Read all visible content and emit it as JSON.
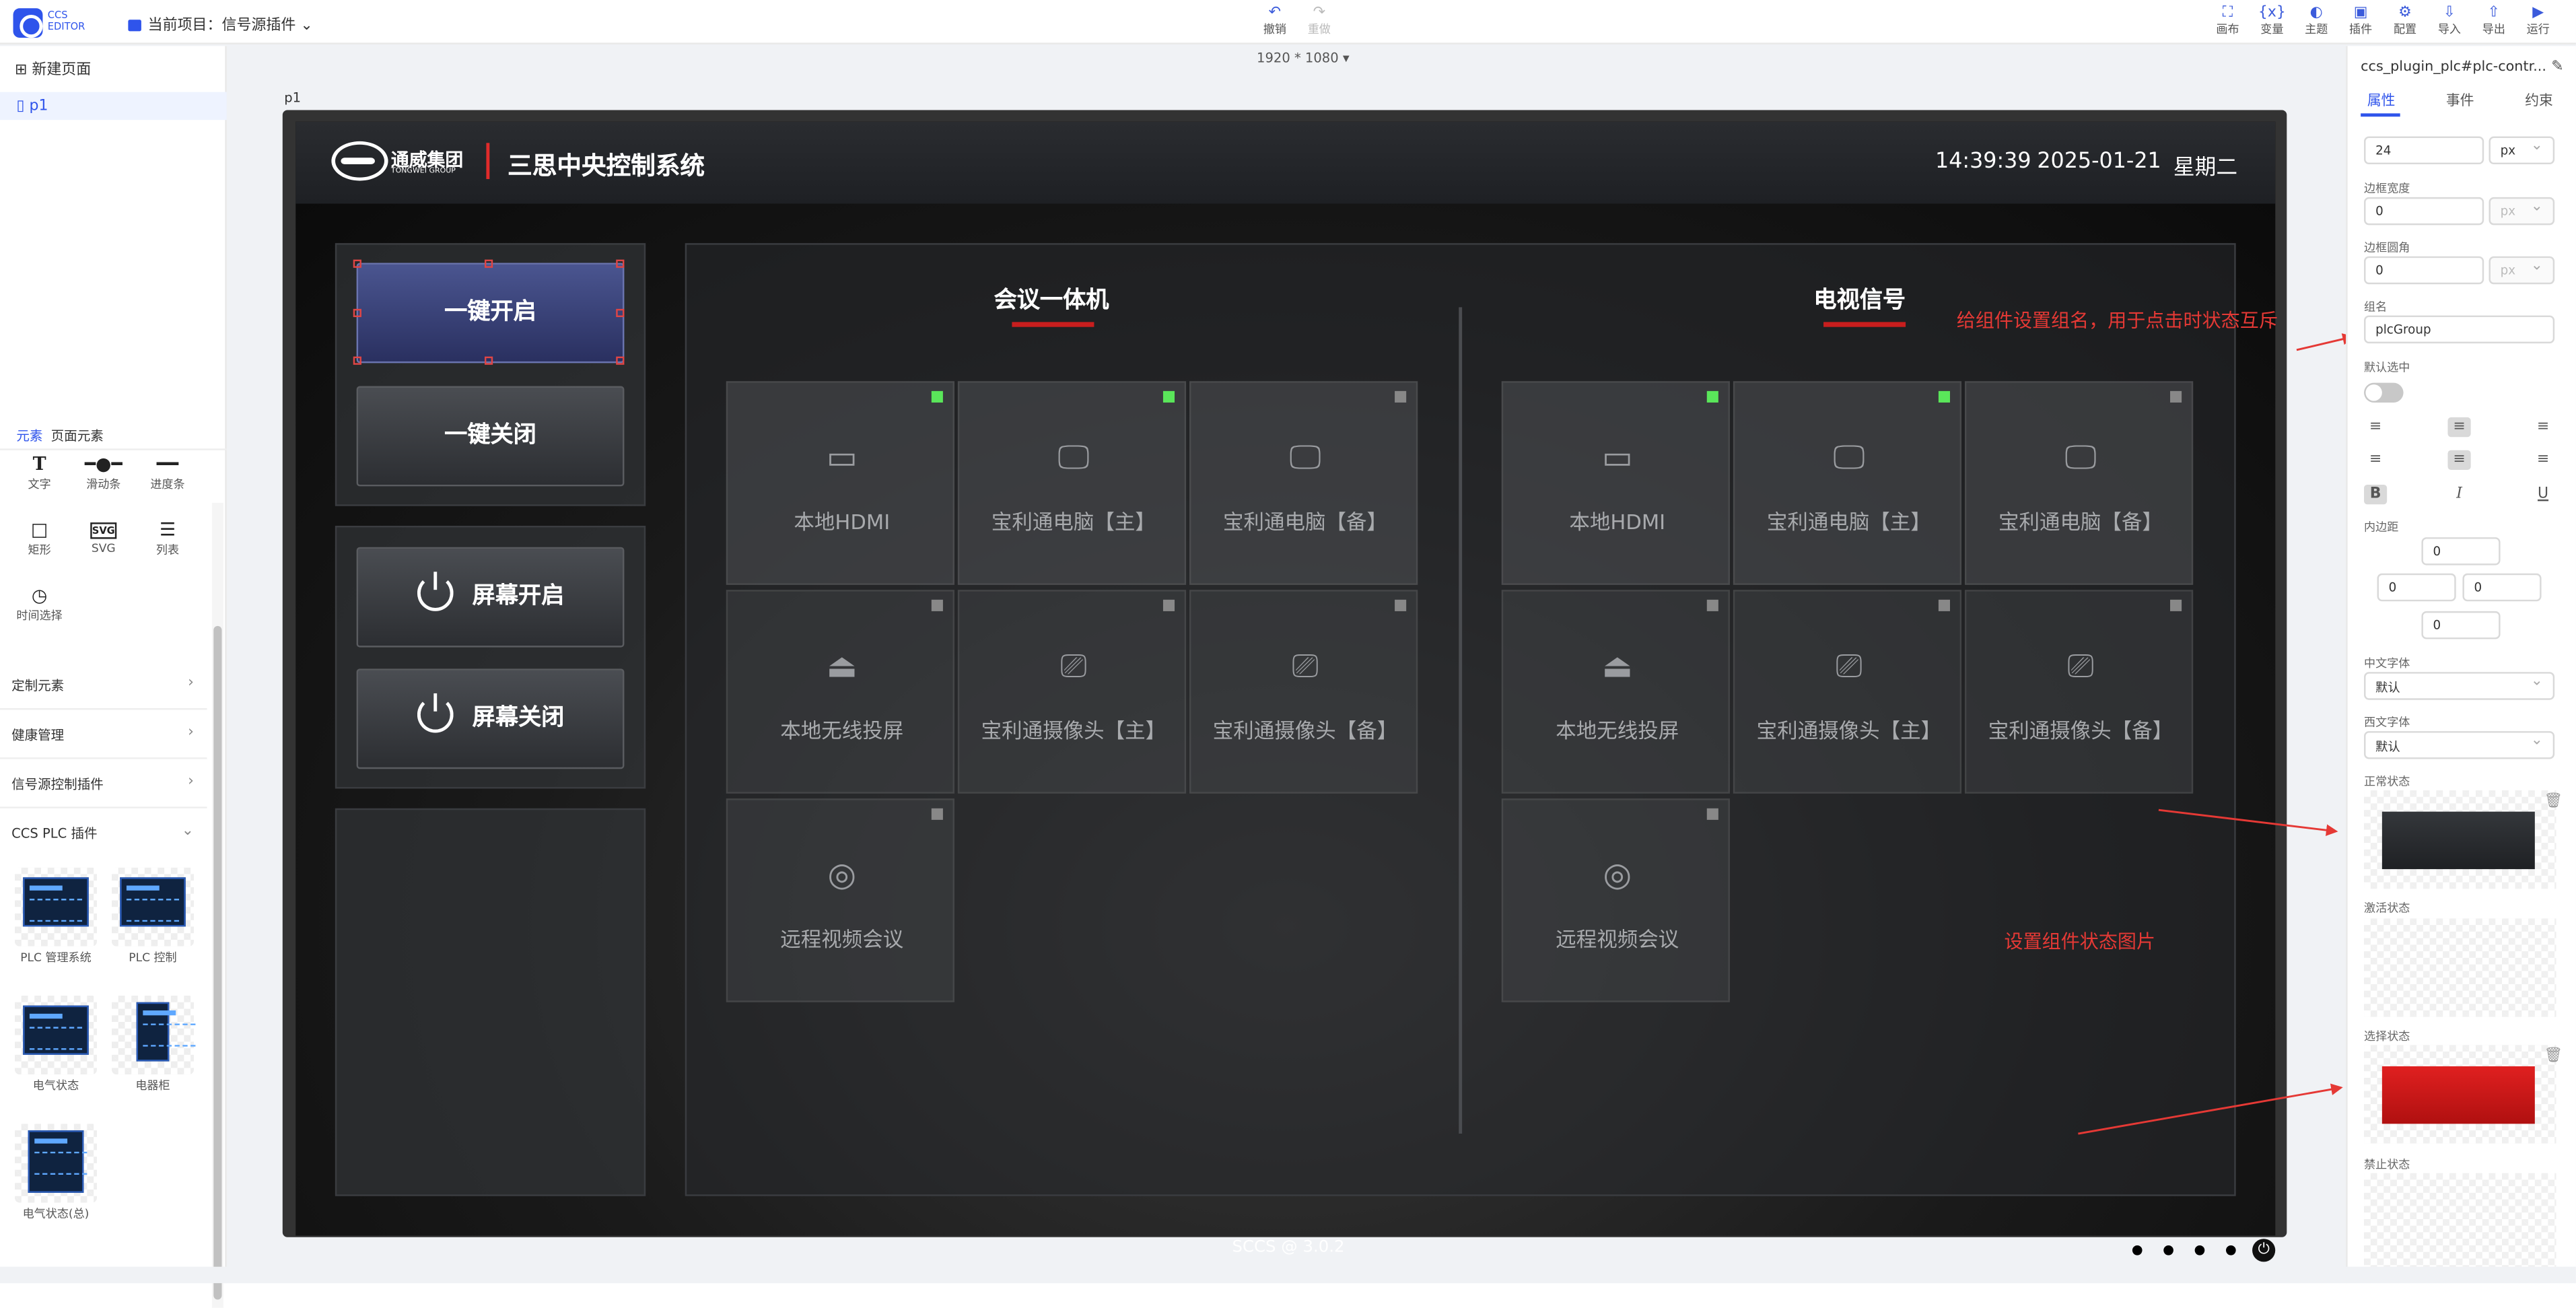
{
  "toolbar": {
    "logo_text": "CCS EDITOR",
    "project_label": "当前项目：",
    "project_name": "信号源插件",
    "undo": "撤销",
    "redo": "重做",
    "actions": [
      "画布",
      "变量",
      "主题",
      "插件",
      "配置",
      "导入",
      "导出",
      "运行"
    ]
  },
  "left_panel": {
    "new_page": "新建页面",
    "pages": [
      "p1"
    ],
    "tabs": [
      "元素",
      "页面元素"
    ],
    "components": [
      "文字",
      "滑动条",
      "进度条",
      "矩形",
      "SVG",
      "列表",
      "时间选择"
    ],
    "sections": [
      "定制元素",
      "健康管理",
      "信号源控制插件",
      "CCS PLC 插件"
    ],
    "plc_plugins": [
      "PLC 管理系统",
      "PLC 控制",
      "电气状态",
      "电器柜",
      "电气状态(总)"
    ]
  },
  "canvas": {
    "size_label": "1920 * 1080",
    "page_label": "p1"
  },
  "screen": {
    "company_cn": "通威集团",
    "company_en": "TONGWEI GROUP",
    "title": "三思中央控制系统",
    "time": "14:39:39",
    "date": "2025-01-21",
    "weekday": "星期二",
    "buttons": {
      "all_on": "一键开启",
      "all_off": "一键关闭",
      "screen_on": "屏幕开启",
      "screen_off": "屏幕关闭"
    },
    "sections": [
      {
        "title": "会议一体机",
        "tiles": [
          {
            "label": "本地HDMI",
            "icon": "hdmi-icon",
            "active": true
          },
          {
            "label": "宝利通电脑【主】",
            "icon": "monitor-icon",
            "active": true
          },
          {
            "label": "宝利通电脑【备】",
            "icon": "monitor-icon",
            "active": false
          },
          {
            "label": "本地无线投屏",
            "icon": "airplay-icon",
            "active": false
          },
          {
            "label": "宝利通摄像头【主】",
            "icon": "camera-icon",
            "active": false
          },
          {
            "label": "宝利通摄像头【备】",
            "icon": "camera-icon",
            "active": false
          },
          {
            "label": "远程视频会议",
            "icon": "webcam-icon",
            "active": false
          }
        ]
      },
      {
        "title": "电视信号",
        "tiles": [
          {
            "label": "本地HDMI",
            "icon": "hdmi-icon",
            "active": true
          },
          {
            "label": "宝利通电脑【主】",
            "icon": "monitor-icon",
            "active": true
          },
          {
            "label": "宝利通电脑【备】",
            "icon": "monitor-icon",
            "active": false
          },
          {
            "label": "本地无线投屏",
            "icon": "airplay-icon",
            "active": false
          },
          {
            "label": "宝利通摄像头【主】",
            "icon": "camera-icon",
            "active": false
          },
          {
            "label": "宝利通摄像头【备】",
            "icon": "camera-icon",
            "active": false
          },
          {
            "label": "远程视频会议",
            "icon": "webcam-icon",
            "active": false
          }
        ]
      }
    ],
    "footer": "SCCS @ 3.0.2"
  },
  "annotations": {
    "group_note": "给组件设置组名，用于点击时状态互斥",
    "image_note": "设置组件状态图片"
  },
  "right_panel": {
    "component_name": "ccs_plugin_plc#plc-contr...",
    "tabs": [
      "属性",
      "事件",
      "约束"
    ],
    "font_size_value": "24",
    "unit_px": "px",
    "border_width_label": "边框宽度",
    "border_width_value": "0",
    "border_radius_label": "边框圆角",
    "border_radius_value": "0",
    "group_label": "组名",
    "group_value": "plcGroup",
    "default_selected_label": "默认选中",
    "padding_label": "内边距",
    "padding_values": [
      "0",
      "0",
      "0",
      "0"
    ],
    "cn_font_label": "中文字体",
    "cn_font_value": "默认",
    "en_font_label": "西文字体",
    "en_font_value": "默认",
    "state_labels": [
      "正常状态",
      "激活状态",
      "选择状态",
      "禁止状态"
    ],
    "colors": {
      "normal": "#34373b",
      "selected": "#e02020"
    }
  }
}
